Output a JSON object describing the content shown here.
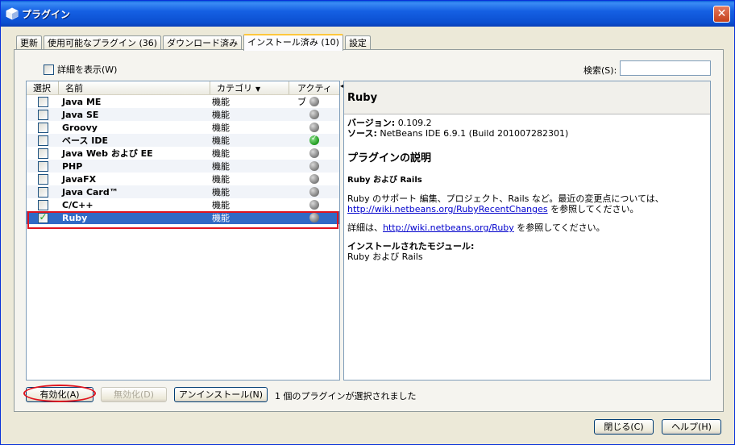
{
  "window": {
    "title": "プラグイン",
    "close": "✕"
  },
  "tabs": [
    {
      "label": "更新"
    },
    {
      "label": "使用可能なプラグイン (36)"
    },
    {
      "label": "ダウンロード済み"
    },
    {
      "label": "インストール済み (10)"
    },
    {
      "label": "設定"
    }
  ],
  "toolbar": {
    "show_details": "詳細を表示(W)",
    "search_label": "検索(S):",
    "search_value": ""
  },
  "list": {
    "headers": {
      "select": "選択",
      "name": "名前",
      "category": "カテゴリ",
      "active": "アクティブ"
    },
    "rows": [
      {
        "name": "Java ME",
        "category": "機能",
        "checked": false,
        "active": false
      },
      {
        "name": "Java SE",
        "category": "機能",
        "checked": false,
        "active": false
      },
      {
        "name": "Groovy",
        "category": "機能",
        "checked": false,
        "active": false
      },
      {
        "name": "ベース IDE",
        "category": "機能",
        "checked": false,
        "active": true
      },
      {
        "name": "Java Web および EE",
        "category": "機能",
        "checked": false,
        "active": false
      },
      {
        "name": "PHP",
        "category": "機能",
        "checked": false,
        "active": false
      },
      {
        "name": "JavaFX",
        "category": "機能",
        "checked": false,
        "active": false
      },
      {
        "name": "Java Card™",
        "category": "機能",
        "checked": false,
        "active": false
      },
      {
        "name": "C/C++",
        "category": "機能",
        "checked": false,
        "active": false
      },
      {
        "name": "Ruby",
        "category": "機能",
        "checked": true,
        "active": false,
        "selected": true
      }
    ]
  },
  "detail": {
    "title": "Ruby",
    "version_label": "バージョン:",
    "version_value": "0.109.2",
    "source_label": "ソース:",
    "source_value": "NetBeans IDE 6.9.1 (Build 201007282301)",
    "desc_heading": "プラグインの説明",
    "desc_subheading": "Ruby および Rails",
    "desc_text_pre": "Ruby のサポート 編集、プロジェクト、Rails など。最近の変更点については、",
    "desc_link": "http://wiki.netbeans.org/RubyRecentChanges",
    "desc_text_post": " を参照してください。",
    "more_pre": "詳細は、",
    "more_link": "http://wiki.netbeans.org/Ruby",
    "more_post": " を参照してください。",
    "modules_heading": "インストールされたモジュール:",
    "modules_value": "Ruby および Rails"
  },
  "actions": {
    "enable": "有効化(A)",
    "disable": "無効化(D)",
    "uninstall": "アンインストール(N)",
    "status": "1 個のプラグインが選択されました"
  },
  "footer": {
    "close": "閉じる(C)",
    "help": "ヘルプ(H)"
  },
  "colors": {
    "selection": "#316ac5",
    "highlight": "#e0141e",
    "titlebar": "#0b4fd0"
  }
}
